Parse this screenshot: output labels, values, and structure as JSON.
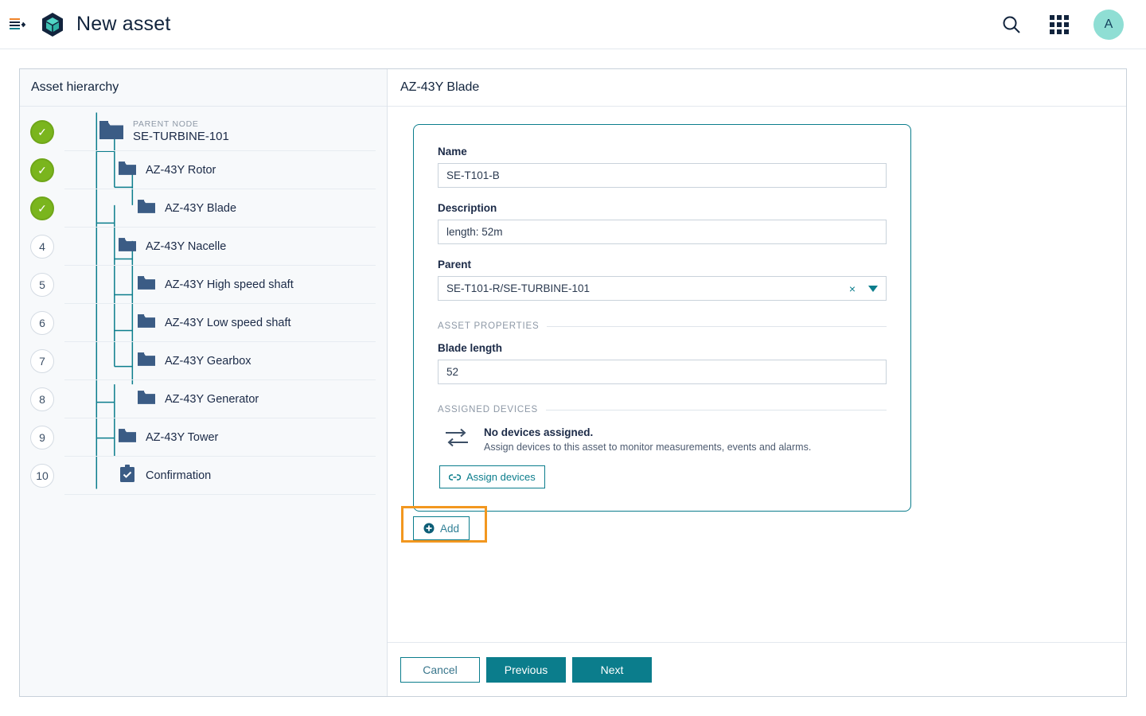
{
  "header": {
    "title": "New asset",
    "menu_icon": "list-toggle-icon",
    "logo_icon": "cube-icon",
    "search_icon": "search-icon",
    "apps_icon": "app-grid-icon",
    "avatar_initial": "A"
  },
  "left_panel": {
    "title": "Asset hierarchy",
    "items": [
      {
        "badge": "check",
        "badge_label": "✓",
        "kicker": "PARENT NODE",
        "label": "SE-TURBINE-101",
        "depth": 0,
        "icon": "folder-icon"
      },
      {
        "badge": "check",
        "badge_label": "✓",
        "kicker": "",
        "label": "AZ-43Y Rotor",
        "depth": 1,
        "icon": "folder-icon"
      },
      {
        "badge": "check",
        "badge_label": "✓",
        "kicker": "",
        "label": "AZ-43Y Blade",
        "depth": 2,
        "icon": "folder-icon"
      },
      {
        "badge": "num",
        "badge_label": "4",
        "kicker": "",
        "label": "AZ-43Y Nacelle",
        "depth": 1,
        "icon": "folder-icon"
      },
      {
        "badge": "num",
        "badge_label": "5",
        "kicker": "",
        "label": "AZ-43Y High speed shaft",
        "depth": 2,
        "icon": "folder-icon"
      },
      {
        "badge": "num",
        "badge_label": "6",
        "kicker": "",
        "label": "AZ-43Y Low speed shaft",
        "depth": 2,
        "icon": "folder-icon"
      },
      {
        "badge": "num",
        "badge_label": "7",
        "kicker": "",
        "label": "AZ-43Y Gearbox",
        "depth": 2,
        "icon": "folder-icon"
      },
      {
        "badge": "num",
        "badge_label": "8",
        "kicker": "",
        "label": "AZ-43Y Generator",
        "depth": 2,
        "icon": "folder-icon"
      },
      {
        "badge": "num",
        "badge_label": "9",
        "kicker": "",
        "label": "AZ-43Y Tower",
        "depth": 1,
        "icon": "folder-icon"
      },
      {
        "badge": "num",
        "badge_label": "10",
        "kicker": "",
        "label": "Confirmation",
        "depth": 1,
        "icon": "clipboard-check-icon"
      }
    ]
  },
  "right_panel": {
    "title": "AZ-43Y Blade",
    "fields": {
      "name_label": "Name",
      "name_value": "SE-T101-B",
      "description_label": "Description",
      "description_value": "length: 52m",
      "parent_label": "Parent",
      "parent_value": "SE-T101-R/SE-TURBINE-101",
      "clear_icon": "×",
      "caret_icon": "chevron-down-icon"
    },
    "asset_properties": {
      "section_title": "ASSET PROPERTIES",
      "blade_length_label": "Blade length",
      "blade_length_value": "52"
    },
    "assigned_devices": {
      "section_title": "ASSIGNED DEVICES",
      "empty_title": "No devices assigned.",
      "empty_subtitle": "Assign devices to this asset to monitor measurements, events and alarms.",
      "assign_button": "Assign devices",
      "assign_icon": "link-icon",
      "exchange_icon": "arrows-exchange-icon"
    },
    "add_button": "Add",
    "add_icon": "plus-circle-icon"
  },
  "footer": {
    "cancel": "Cancel",
    "previous": "Previous",
    "next": "Next"
  },
  "colors": {
    "accent_teal": "#0b7d8c",
    "done_green": "#7ab51d",
    "highlight_orange": "#f2971f",
    "folder_blue": "#3b5c85",
    "avatar_bg": "#8fded4"
  }
}
